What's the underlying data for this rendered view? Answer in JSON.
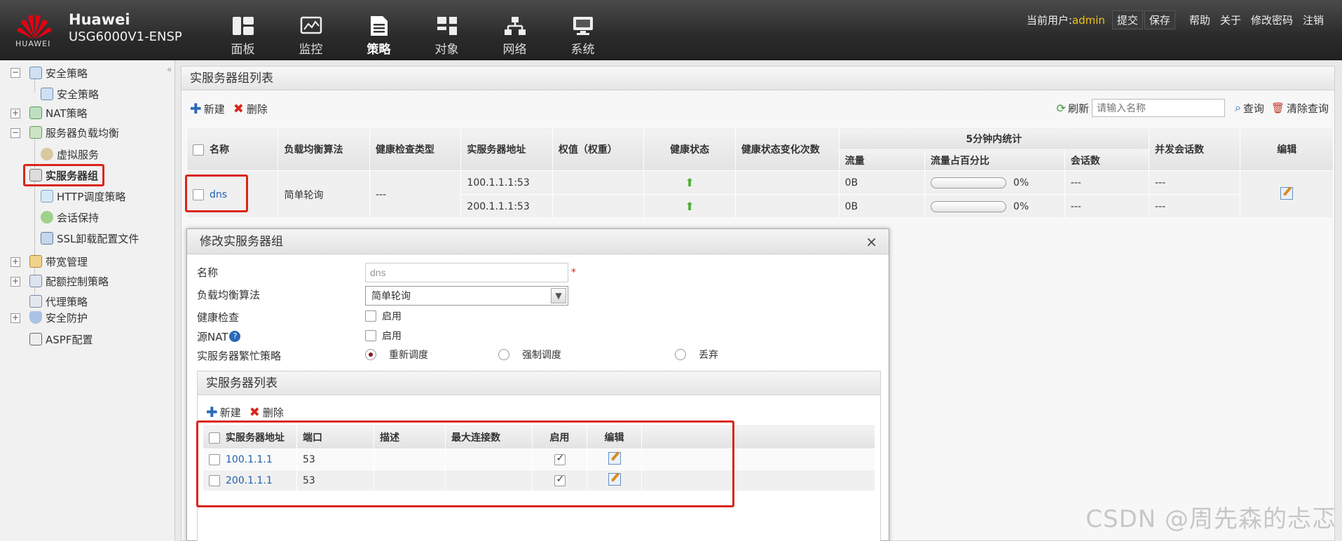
{
  "topbar": {
    "logo_text": "HUAWEI",
    "brand": "Huawei",
    "model": "USG6000V1-ENSP",
    "nav": [
      {
        "label": "面板",
        "icon": "dashboard-icon"
      },
      {
        "label": "监控",
        "icon": "monitor-icon"
      },
      {
        "label": "策略",
        "icon": "policy-icon",
        "active": true
      },
      {
        "label": "对象",
        "icon": "object-icon"
      },
      {
        "label": "网络",
        "icon": "network-icon"
      },
      {
        "label": "系统",
        "icon": "system-icon"
      }
    ],
    "user_label": "当前用户:",
    "user_name": "admin",
    "submit": "提交",
    "save": "保存",
    "help": "帮助",
    "about": "关于",
    "change_password": "修改密码",
    "logout": "注销"
  },
  "sidebar": {
    "items": [
      {
        "label": "安全策略"
      },
      {
        "label": "安全策略"
      },
      {
        "label": "NAT策略"
      },
      {
        "label": "服务器负载均衡"
      },
      {
        "label": "虚拟服务"
      },
      {
        "label": "实服务器组"
      },
      {
        "label": "HTTP调度策略"
      },
      {
        "label": "会话保持"
      },
      {
        "label": "SSL卸载配置文件"
      },
      {
        "label": "带宽管理"
      },
      {
        "label": "配额控制策略"
      },
      {
        "label": "代理策略"
      },
      {
        "label": "安全防护"
      },
      {
        "label": "ASPF配置"
      }
    ]
  },
  "main": {
    "title": "实服务器组列表",
    "new_label": "新建",
    "delete_label": "删除",
    "refresh_label": "刷新",
    "search_placeholder": "请输入名称",
    "query_label": "查询",
    "clear_query_label": "清除查询",
    "columns": {
      "name": "名称",
      "algorithm": "负载均衡算法",
      "health_type": "健康检查类型",
      "server_addr": "实服务器地址",
      "weight": "权值（权重）",
      "health_status": "健康状态",
      "health_changes": "健康状态变化次数",
      "stats_5min": "5分钟内统计",
      "traffic": "流量",
      "traffic_pct": "流量占百分比",
      "sessions": "会话数",
      "concurrent": "并发会话数",
      "edit": "编辑"
    },
    "rows": [
      {
        "name": "dns",
        "algorithm": "简单轮询",
        "health_type": "---",
        "servers": [
          {
            "addr": "100.1.1.1:53",
            "traffic": "0B",
            "pct": "0%",
            "sessions": "---",
            "concurrent": "---"
          },
          {
            "addr": "200.1.1.1:53",
            "traffic": "0B",
            "pct": "0%",
            "sessions": "---",
            "concurrent": "---"
          }
        ]
      }
    ]
  },
  "dialog": {
    "title": "修改实服务器组",
    "close": "×",
    "name_label": "名称",
    "name_value": "dns",
    "algorithm_label": "负载均衡算法",
    "algorithm_value": "简单轮询",
    "health_label": "健康检查",
    "health_opt": "启用",
    "srcnat_label": "源NAT",
    "srcnat_help": "?",
    "srcnat_opt": "启用",
    "busy_label": "实服务器繁忙策略",
    "busy_options": [
      "重新调度",
      "强制调度",
      "丢弃"
    ],
    "sub_title": "实服务器列表",
    "sub_new": "新建",
    "sub_delete": "删除",
    "sub_columns": {
      "addr": "实服务器地址",
      "port": "端口",
      "desc": "描述",
      "maxconn": "最大连接数",
      "enable": "启用",
      "edit": "编辑"
    },
    "sub_rows": [
      {
        "addr": "100.1.1.1",
        "port": "53",
        "enabled": true
      },
      {
        "addr": "200.1.1.1",
        "port": "53",
        "enabled": true
      }
    ]
  },
  "watermark": "CSDN @周先森的忐忑",
  "colors": {
    "accent_red": "#d9261c",
    "link_blue": "#1f5fb0",
    "user_yellow": "#f0c419"
  }
}
